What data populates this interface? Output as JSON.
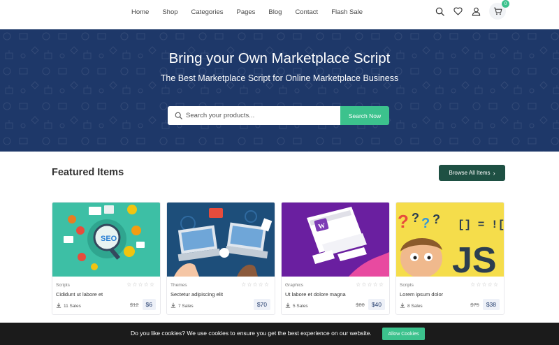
{
  "nav": {
    "links": [
      "Home",
      "Shop",
      "Categories",
      "Pages",
      "Blog",
      "Contact",
      "Flash Sale"
    ],
    "cart_count": "0",
    "icons": [
      "search-icon",
      "heart-icon",
      "user-icon",
      "cart-icon"
    ]
  },
  "hero": {
    "title": "Bring your Own Marketplace Script",
    "subtitle": "The Best Marketplace Script for Online Marketplace Business",
    "search_placeholder": "Search your products...",
    "search_button": "Search Now",
    "bg_color": "#1e3869"
  },
  "featured": {
    "title": "Featured Items",
    "browse_label": "Browse All Items",
    "items": [
      {
        "category": "Scripts",
        "name": "Cididunt ut labore et",
        "sales": "11 Sales",
        "old_price": "$12",
        "price": "$6",
        "rating": 0
      },
      {
        "category": "Themes",
        "name": "Sectetur adipiscing elit",
        "sales": "7 Sales",
        "old_price": "",
        "price": "$70",
        "rating": 0
      },
      {
        "category": "Graphics",
        "name": "Ut labore et dolore magna",
        "sales": "5 Sales",
        "old_price": "$80",
        "price": "$40",
        "rating": 0
      },
      {
        "category": "Scripts",
        "name": "Lorem ipsum dolor",
        "sales": "8 Sales",
        "old_price": "$75",
        "price": "$38",
        "rating": 0
      }
    ]
  },
  "cookie": {
    "text": "Do you like cookies? We use cookies to ensure you get the best experience on our website.",
    "button": "Allow Cookies"
  },
  "colors": {
    "accent_green": "#3cc28d",
    "dark_green": "#1e5043",
    "navy": "#1e3869"
  }
}
